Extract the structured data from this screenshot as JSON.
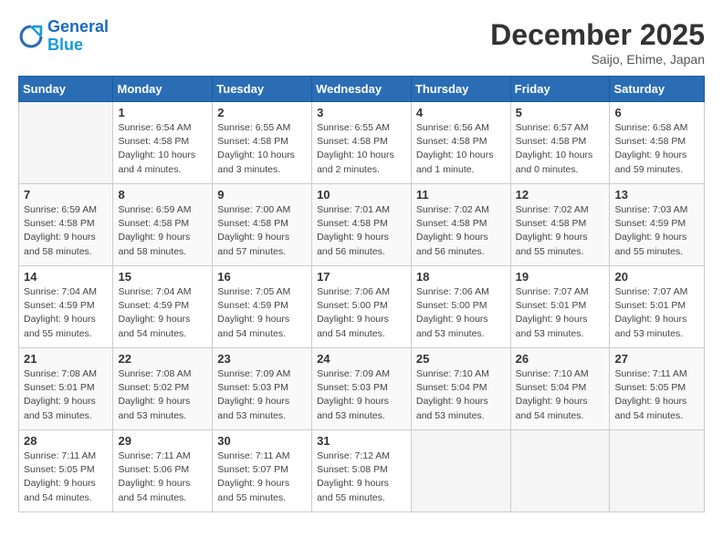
{
  "logo": {
    "line1": "General",
    "line2": "Blue"
  },
  "title": "December 2025",
  "subtitle": "Saijo, Ehime, Japan",
  "days_of_week": [
    "Sunday",
    "Monday",
    "Tuesday",
    "Wednesday",
    "Thursday",
    "Friday",
    "Saturday"
  ],
  "weeks": [
    [
      {
        "day": "",
        "info": ""
      },
      {
        "day": "1",
        "info": "Sunrise: 6:54 AM\nSunset: 4:58 PM\nDaylight: 10 hours\nand 4 minutes."
      },
      {
        "day": "2",
        "info": "Sunrise: 6:55 AM\nSunset: 4:58 PM\nDaylight: 10 hours\nand 3 minutes."
      },
      {
        "day": "3",
        "info": "Sunrise: 6:55 AM\nSunset: 4:58 PM\nDaylight: 10 hours\nand 2 minutes."
      },
      {
        "day": "4",
        "info": "Sunrise: 6:56 AM\nSunset: 4:58 PM\nDaylight: 10 hours\nand 1 minute."
      },
      {
        "day": "5",
        "info": "Sunrise: 6:57 AM\nSunset: 4:58 PM\nDaylight: 10 hours\nand 0 minutes."
      },
      {
        "day": "6",
        "info": "Sunrise: 6:58 AM\nSunset: 4:58 PM\nDaylight: 9 hours\nand 59 minutes."
      }
    ],
    [
      {
        "day": "7",
        "info": "Sunrise: 6:59 AM\nSunset: 4:58 PM\nDaylight: 9 hours\nand 58 minutes."
      },
      {
        "day": "8",
        "info": "Sunrise: 6:59 AM\nSunset: 4:58 PM\nDaylight: 9 hours\nand 58 minutes."
      },
      {
        "day": "9",
        "info": "Sunrise: 7:00 AM\nSunset: 4:58 PM\nDaylight: 9 hours\nand 57 minutes."
      },
      {
        "day": "10",
        "info": "Sunrise: 7:01 AM\nSunset: 4:58 PM\nDaylight: 9 hours\nand 56 minutes."
      },
      {
        "day": "11",
        "info": "Sunrise: 7:02 AM\nSunset: 4:58 PM\nDaylight: 9 hours\nand 56 minutes."
      },
      {
        "day": "12",
        "info": "Sunrise: 7:02 AM\nSunset: 4:58 PM\nDaylight: 9 hours\nand 55 minutes."
      },
      {
        "day": "13",
        "info": "Sunrise: 7:03 AM\nSunset: 4:59 PM\nDaylight: 9 hours\nand 55 minutes."
      }
    ],
    [
      {
        "day": "14",
        "info": "Sunrise: 7:04 AM\nSunset: 4:59 PM\nDaylight: 9 hours\nand 55 minutes."
      },
      {
        "day": "15",
        "info": "Sunrise: 7:04 AM\nSunset: 4:59 PM\nDaylight: 9 hours\nand 54 minutes."
      },
      {
        "day": "16",
        "info": "Sunrise: 7:05 AM\nSunset: 4:59 PM\nDaylight: 9 hours\nand 54 minutes."
      },
      {
        "day": "17",
        "info": "Sunrise: 7:06 AM\nSunset: 5:00 PM\nDaylight: 9 hours\nand 54 minutes."
      },
      {
        "day": "18",
        "info": "Sunrise: 7:06 AM\nSunset: 5:00 PM\nDaylight: 9 hours\nand 53 minutes."
      },
      {
        "day": "19",
        "info": "Sunrise: 7:07 AM\nSunset: 5:01 PM\nDaylight: 9 hours\nand 53 minutes."
      },
      {
        "day": "20",
        "info": "Sunrise: 7:07 AM\nSunset: 5:01 PM\nDaylight: 9 hours\nand 53 minutes."
      }
    ],
    [
      {
        "day": "21",
        "info": "Sunrise: 7:08 AM\nSunset: 5:01 PM\nDaylight: 9 hours\nand 53 minutes."
      },
      {
        "day": "22",
        "info": "Sunrise: 7:08 AM\nSunset: 5:02 PM\nDaylight: 9 hours\nand 53 minutes."
      },
      {
        "day": "23",
        "info": "Sunrise: 7:09 AM\nSunset: 5:03 PM\nDaylight: 9 hours\nand 53 minutes."
      },
      {
        "day": "24",
        "info": "Sunrise: 7:09 AM\nSunset: 5:03 PM\nDaylight: 9 hours\nand 53 minutes."
      },
      {
        "day": "25",
        "info": "Sunrise: 7:10 AM\nSunset: 5:04 PM\nDaylight: 9 hours\nand 53 minutes."
      },
      {
        "day": "26",
        "info": "Sunrise: 7:10 AM\nSunset: 5:04 PM\nDaylight: 9 hours\nand 54 minutes."
      },
      {
        "day": "27",
        "info": "Sunrise: 7:11 AM\nSunset: 5:05 PM\nDaylight: 9 hours\nand 54 minutes."
      }
    ],
    [
      {
        "day": "28",
        "info": "Sunrise: 7:11 AM\nSunset: 5:05 PM\nDaylight: 9 hours\nand 54 minutes."
      },
      {
        "day": "29",
        "info": "Sunrise: 7:11 AM\nSunset: 5:06 PM\nDaylight: 9 hours\nand 54 minutes."
      },
      {
        "day": "30",
        "info": "Sunrise: 7:11 AM\nSunset: 5:07 PM\nDaylight: 9 hours\nand 55 minutes."
      },
      {
        "day": "31",
        "info": "Sunrise: 7:12 AM\nSunset: 5:08 PM\nDaylight: 9 hours\nand 55 minutes."
      },
      {
        "day": "",
        "info": ""
      },
      {
        "day": "",
        "info": ""
      },
      {
        "day": "",
        "info": ""
      }
    ]
  ]
}
